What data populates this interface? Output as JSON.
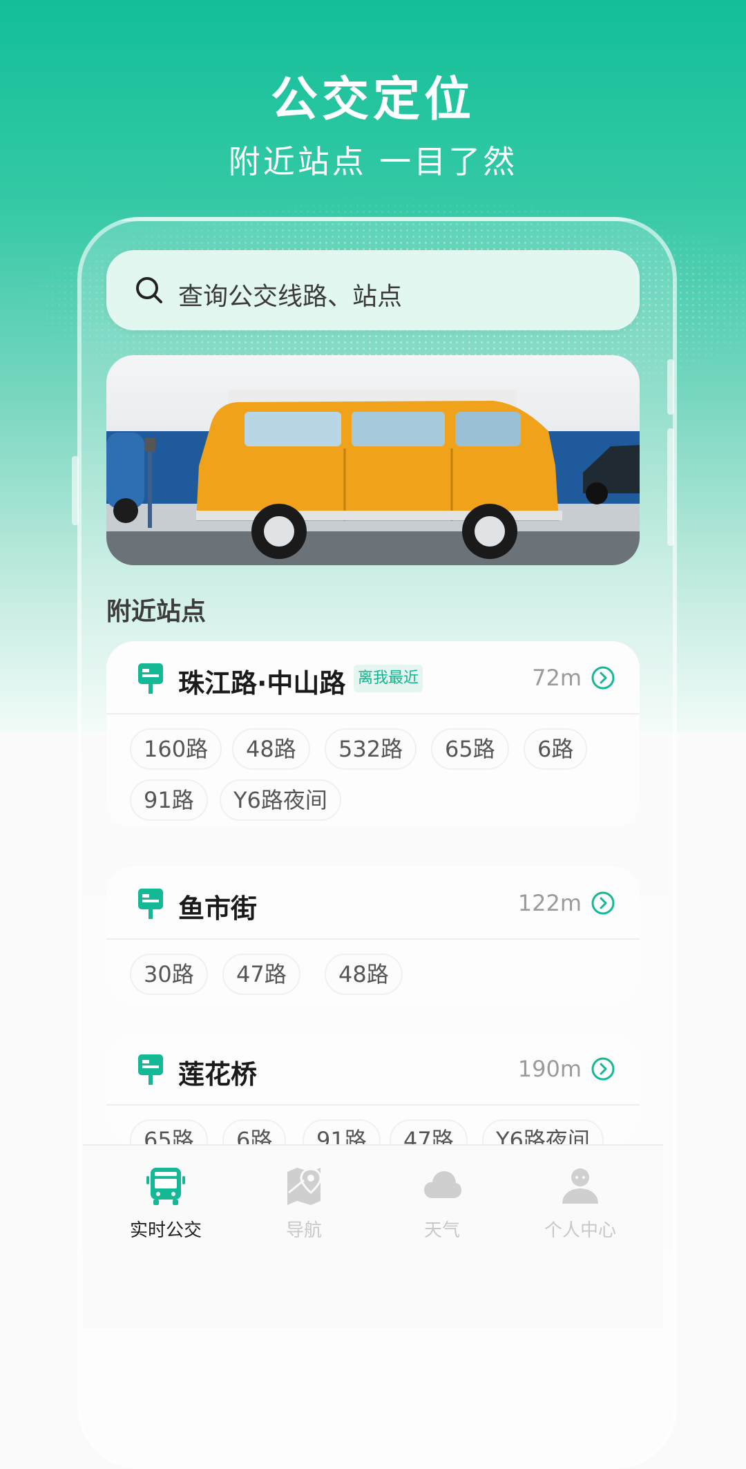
{
  "hero": {
    "title": "公交定位",
    "subtitle": "附近站点 一目了然"
  },
  "search": {
    "placeholder": "查询公交线路、站点"
  },
  "nearby": {
    "title": "附近站点",
    "stations": [
      {
        "name": "珠江路·中山路",
        "badge": "离我最近",
        "distance": "72m",
        "routes": [
          "160路",
          "48路",
          "532路",
          "65路",
          "6路",
          "91路",
          "Y6路夜间"
        ]
      },
      {
        "name": "鱼市街",
        "distance": "122m",
        "routes": [
          "30路",
          "47路",
          "48路"
        ]
      },
      {
        "name": "莲花桥",
        "distance": "190m",
        "routes": [
          "65路",
          "6路",
          "91路",
          "47路",
          "Y6路夜间"
        ]
      }
    ]
  },
  "nav": {
    "items": [
      {
        "label": "实时公交",
        "icon": "bus-icon",
        "active": true
      },
      {
        "label": "导航",
        "icon": "map-pin-icon",
        "active": false
      },
      {
        "label": "天气",
        "icon": "cloud-icon",
        "active": false
      },
      {
        "label": "个人中心",
        "icon": "user-icon",
        "active": false
      }
    ]
  },
  "colors": {
    "accent": "#12b48f",
    "hero_top": "#12bf98",
    "banner_van": "#f0a21b"
  }
}
